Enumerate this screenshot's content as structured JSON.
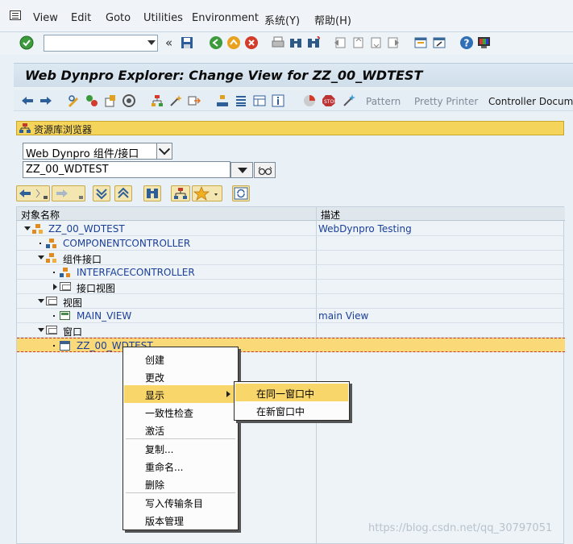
{
  "menubar": {
    "items": [
      "View",
      "Edit",
      "Goto",
      "Utilities",
      "Environment",
      "系统(Y)",
      "帮助(H)"
    ]
  },
  "stdbar": {
    "command_value": "",
    "nav_back_glyph": "«"
  },
  "title": "Web Dynpro Explorer: Change View for ZZ_00_WDTEST",
  "appbar": {
    "pattern": "Pattern",
    "pretty_printer": "Pretty Printer",
    "controller_doc": "Controller Documer"
  },
  "repo": {
    "header": "资源库浏览器",
    "object_type": "Web Dynpro 组件/接口",
    "object_name": "ZZ_00_WDTEST",
    "go_glyph": "&#x2B;"
  },
  "tree": {
    "col_name": "对象名称",
    "col_desc": "描述",
    "rows": [
      {
        "name": "ZZ_00_WDTEST",
        "desc": "WebDynpro Testing"
      },
      {
        "name": "COMPONENTCONTROLLER",
        "desc": ""
      },
      {
        "name": "组件接口",
        "desc": ""
      },
      {
        "name": "INTERFACECONTROLLER",
        "desc": ""
      },
      {
        "name": "接口视图",
        "desc": ""
      },
      {
        "name": "视图",
        "desc": ""
      },
      {
        "name": "MAIN_VIEW",
        "desc": "main View"
      },
      {
        "name": "窗口",
        "desc": ""
      },
      {
        "name": "ZZ_00_WDTEST",
        "desc": ""
      }
    ]
  },
  "context_menu": {
    "items": [
      "创建",
      "更改",
      "显示",
      "一致性检查",
      "激活",
      "复制...",
      "重命名...",
      "删除",
      "写入传输条目",
      "版本管理"
    ],
    "highlighted": "显示"
  },
  "submenu": {
    "items": [
      "在同一窗口中",
      "在新窗口中"
    ],
    "highlighted": "在同一窗口中"
  },
  "watermark": "https://blog.csdn.net/qq_30797051"
}
